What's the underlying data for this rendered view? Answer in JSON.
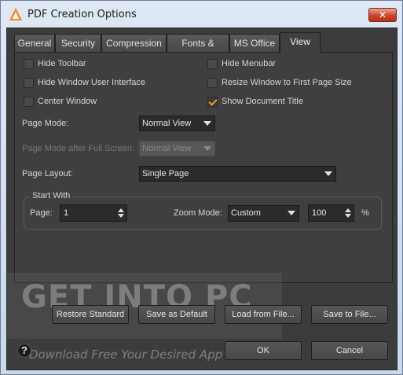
{
  "window": {
    "title": "PDF Creation Options",
    "close_label": "✕"
  },
  "tabs": [
    "General",
    "Security",
    "Compression",
    "Fonts & Colors",
    "MS Office",
    "View"
  ],
  "active_tab": "View",
  "checkboxes": {
    "hide_toolbar": {
      "label": "Hide Toolbar",
      "checked": false
    },
    "hide_menubar": {
      "label": "Hide Menubar",
      "checked": false
    },
    "hide_window_ui": {
      "label": "Hide Window User Interface",
      "checked": false
    },
    "resize_window": {
      "label": "Resize Window to First Page Size",
      "checked": false
    },
    "center_window": {
      "label": "Center Window",
      "checked": false
    },
    "show_doc_title": {
      "label": "Show Document Title",
      "checked": true
    }
  },
  "page_mode": {
    "label": "Page Mode:",
    "value": "Normal View"
  },
  "page_mode_fullscreen": {
    "label": "Page Mode after Full Screen:",
    "value": "Normal View",
    "enabled": false
  },
  "page_layout": {
    "label": "Page Layout:",
    "value": "Single Page"
  },
  "start_with": {
    "title": "Start With",
    "page_label": "Page:",
    "page_value": "1",
    "zoom_mode_label": "Zoom Mode:",
    "zoom_mode_value": "Custom",
    "zoom_value": "100",
    "zoom_unit": "%"
  },
  "buttons": {
    "restore_standard": "Restore Standard",
    "save_as_default": "Save as Default",
    "load_from_file": "Load from File...",
    "save_to_file": "Save to File...",
    "ok": "OK",
    "cancel": "Cancel",
    "help": "?"
  },
  "watermark": {
    "text": "GET INTO PC",
    "subtext": "Download Free Your Desired App"
  },
  "colors": {
    "accent": "#f39c24",
    "background": "#3c3c3c"
  }
}
